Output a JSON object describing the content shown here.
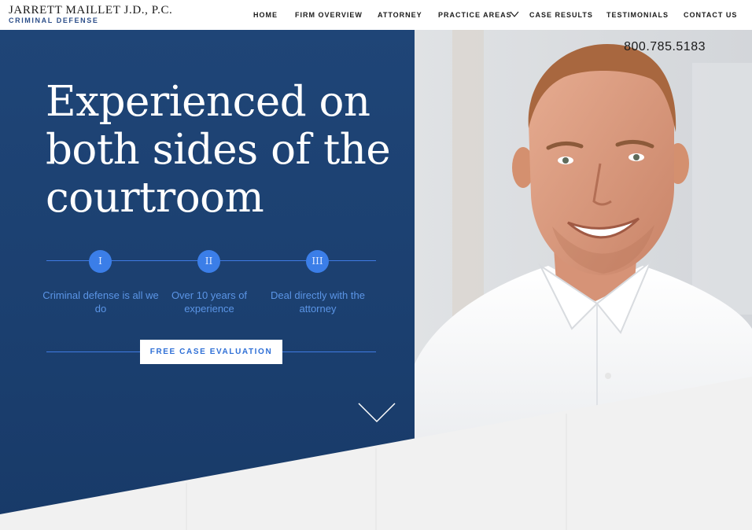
{
  "header": {
    "logo_name": "JARRETT MAILLET J.D., P.C.",
    "logo_sub": "CRIMINAL DEFENSE",
    "nav": [
      {
        "label": "HOME"
      },
      {
        "label": "FIRM OVERVIEW"
      },
      {
        "label": "ATTORNEY"
      },
      {
        "label": "PRACTICE AREAS"
      },
      {
        "label": "CASE RESULTS"
      },
      {
        "label": "TESTIMONIALS"
      },
      {
        "label": "CONTACT US"
      }
    ]
  },
  "hero": {
    "phone": "800.785.5183",
    "headline": "Experienced on both sides of the courtroom",
    "steps": [
      {
        "numeral": "I",
        "text": "Criminal defense is all we do"
      },
      {
        "numeral": "II",
        "text": "Over 10 years of experience"
      },
      {
        "numeral": "III",
        "text": "Deal directly with the attorney"
      }
    ],
    "cta_label": "FREE CASE EVALUATION"
  },
  "colors": {
    "navy": "#1b3f6f",
    "accent_blue": "#3b7ee8",
    "logo_blue": "#2d4f8a"
  },
  "icons": {
    "practice_dropdown": "chevron-down-icon",
    "scroll_down": "chevron-down-icon"
  }
}
